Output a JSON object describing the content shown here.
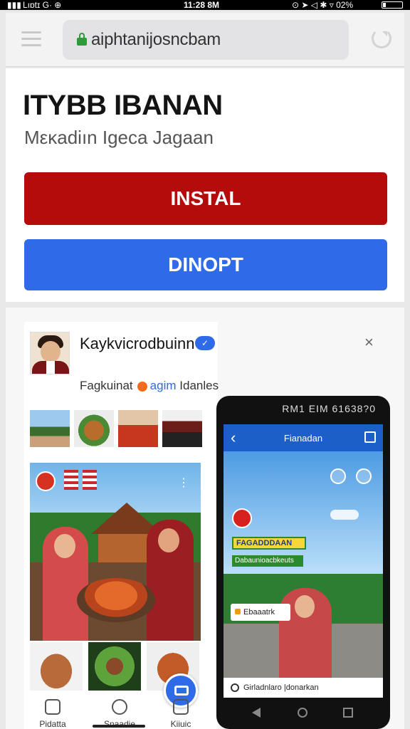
{
  "status_bar": {
    "left_text": "Lıɒtɪ G·  ⊕",
    "time": "11:28 8M",
    "right_text": "⊙ ➤ ◁ ✱ ▿ 02%"
  },
  "browser": {
    "url": "aiphtanijosncbam"
  },
  "app": {
    "title": "IТYBB IBANAN",
    "subtitle": "Mεκadiın Igeca Jagaan",
    "install_label": "INSTAL",
    "second_label": "DINOPT"
  },
  "post": {
    "profile_name": "Kaykvicrodbuinn",
    "verified_mark": "✓",
    "subtitle_prefix": "Fagkuinat",
    "subtitle_tag": "agim",
    "subtitle_suffix": "Idanles",
    "close_glyph": "×",
    "dots_glyph": "⋮",
    "nav": [
      {
        "label": "Pidatta"
      },
      {
        "label": "Snaadie"
      },
      {
        "label": "Kiiuic"
      }
    ]
  },
  "phone": {
    "status": "RM1 EIM 61638?0",
    "header_title": "Fianadan",
    "back_glyph": "‹",
    "banner_primary": "FAGADDDAAN",
    "banner_secondary": "Dabaunioacbkeuts",
    "sticker": "Ebaaatrk",
    "bottom_text": "Girladnlaro |donarkan"
  },
  "colors": {
    "install_button": "#b40b0b",
    "primary_blue": "#2f6be8",
    "lock_green": "#2e9a3a"
  }
}
